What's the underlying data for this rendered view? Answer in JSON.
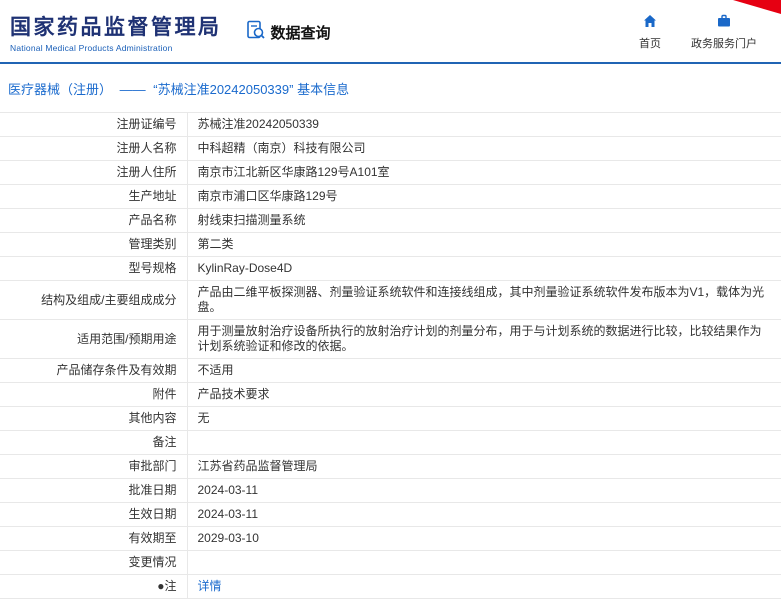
{
  "colors": {
    "accent_blue": "#2064b4",
    "logo_navy": "#1f3274",
    "subtitle_blue": "#1a5fb8",
    "link_blue": "#1a6acd",
    "corner_red": "#e60012",
    "border_gray": "#e8e8e8"
  },
  "header": {
    "title": "国家药品监督管理局",
    "subtitle": "National Medical Products Administration",
    "section_label": "数据查询",
    "nav": [
      {
        "label": "首页",
        "icon": "home-icon"
      },
      {
        "label": "政务服务门户",
        "icon": "briefcase-icon"
      }
    ]
  },
  "breadcrumb": {
    "category": "医疗器械（注册）",
    "separator": "——",
    "title": "“苏械注准20242050339” 基本信息"
  },
  "table": {
    "rows": [
      {
        "label": "注册证编号",
        "value": "苏械注准20242050339"
      },
      {
        "label": "注册人名称",
        "value": "中科超精（南京）科技有限公司"
      },
      {
        "label": "注册人住所",
        "value": "南京市江北新区华康路129号A101室"
      },
      {
        "label": "生产地址",
        "value": "南京市浦口区华康路129号"
      },
      {
        "label": "产品名称",
        "value": "射线束扫描测量系统"
      },
      {
        "label": "管理类别",
        "value": "第二类"
      },
      {
        "label": "型号规格",
        "value": "KylinRay-Dose4D"
      },
      {
        "label": "结构及组成/主要组成成分",
        "value": "产品由二维平板探测器、剂量验证系统软件和连接线组成，其中剂量验证系统软件发布版本为V1，载体为光盘。"
      },
      {
        "label": "适用范围/预期用途",
        "value": "用于测量放射治疗设备所执行的放射治疗计划的剂量分布，用于与计划系统的数据进行比较，比较结果作为计划系统验证和修改的依据。"
      },
      {
        "label": "产品储存条件及有效期",
        "value": "不适用"
      },
      {
        "label": "附件",
        "value": "产品技术要求"
      },
      {
        "label": "其他内容",
        "value": "无"
      },
      {
        "label": "备注",
        "value": ""
      },
      {
        "label": "审批部门",
        "value": "江苏省药品监督管理局"
      },
      {
        "label": "批准日期",
        "value": "2024-03-11"
      },
      {
        "label": "生效日期",
        "value": "2024-03-11"
      },
      {
        "label": "有效期至",
        "value": "2029-03-10"
      },
      {
        "label": "变更情况",
        "value": ""
      },
      {
        "label": "●注",
        "value": "详情",
        "link": true
      }
    ]
  }
}
